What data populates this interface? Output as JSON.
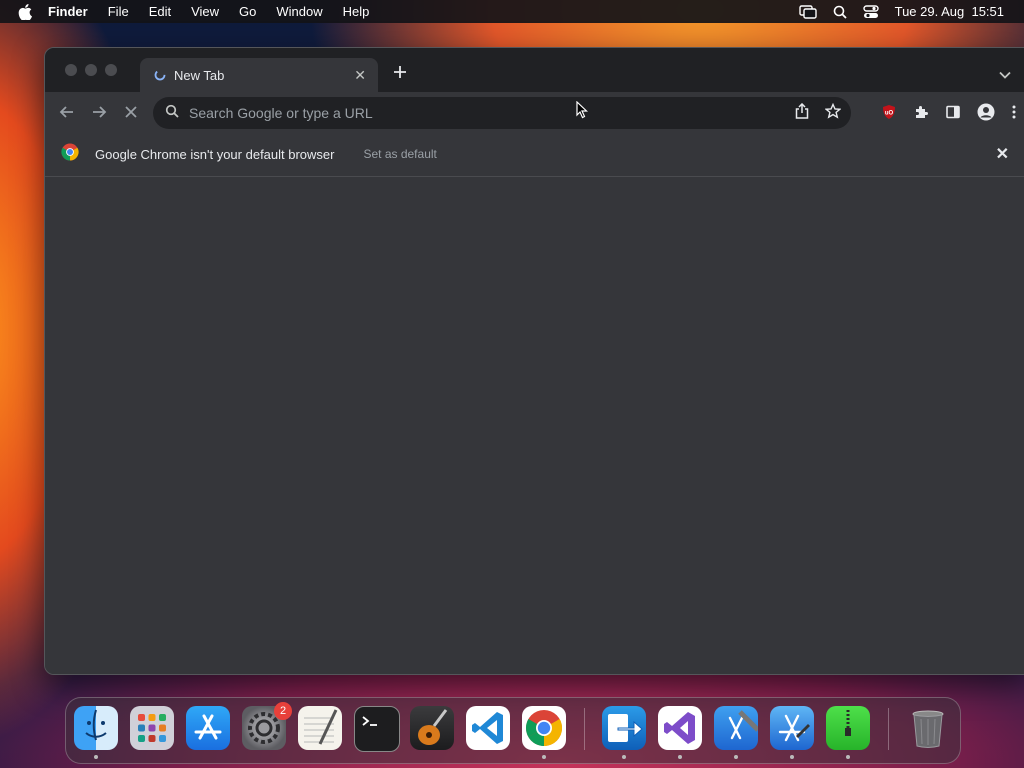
{
  "menubar": {
    "app_name": "Finder",
    "menus": [
      "File",
      "Edit",
      "View",
      "Go",
      "Window",
      "Help"
    ],
    "clock": "Tue 29. Aug  15:51"
  },
  "browser": {
    "tab": {
      "title": "New Tab"
    },
    "omnibox": {
      "placeholder": "Search Google or type a URL"
    },
    "infobar": {
      "message": "Google Chrome isn't your default browser",
      "action": "Set as default"
    }
  },
  "dock": {
    "apps": [
      "Finder",
      "Launchpad",
      "App Store",
      "System Settings",
      "TextEdit",
      "Terminal",
      "GarageBand",
      "Visual Studio Code",
      "Google Chrome",
      "Migration Assistant",
      "Visual Studio",
      "Xcode",
      "Simulator",
      "Archive Utility",
      "Trash"
    ],
    "settings_badge": "2"
  },
  "colors": {
    "window_bg": "#35363a",
    "tabstrip_bg": "#202124",
    "omnibox_bg": "#202124",
    "text": "#e8eaed",
    "muted_text": "#9aa0a6",
    "ublock_red": "#c3131a"
  }
}
